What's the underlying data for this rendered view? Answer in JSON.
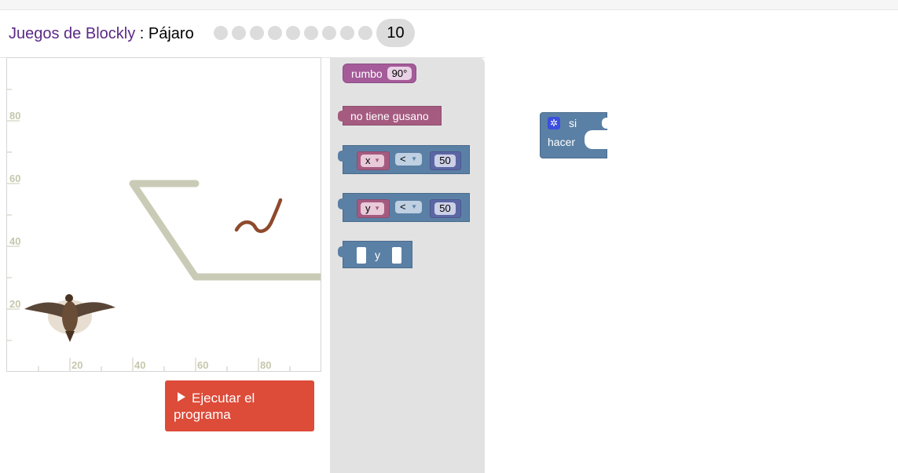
{
  "header": {
    "games_link": "Juegos de Blockly",
    "separator": " : ",
    "game_name": "Pájaro",
    "levels": [
      "1",
      "2",
      "3",
      "4",
      "5",
      "6",
      "7",
      "8",
      "9"
    ],
    "current_level": "10"
  },
  "visualization": {
    "y_axis_labels": [
      "80",
      "60",
      "40",
      "20"
    ],
    "x_axis_labels": [
      "20",
      "40",
      "60",
      "80"
    ],
    "grid_color": "#c9cab4",
    "wall_color": "#cacbb6"
  },
  "run_button": {
    "label_line1": "Ejecutar el",
    "label_line2": "programa",
    "color": "#dd4b39"
  },
  "toolbox": {
    "heading_block": {
      "label": "rumbo",
      "value": "90°"
    },
    "no_worm_block": {
      "label": "no tiene gusano"
    },
    "compare_x": {
      "var": "x",
      "op": "<",
      "value": "50"
    },
    "compare_y": {
      "var": "y",
      "op": "<",
      "value": "50"
    },
    "and_block": {
      "label": "y"
    }
  },
  "workspace": {
    "if_block": {
      "if_label": "si",
      "do_label": "hacer"
    }
  },
  "colors": {
    "logic_block": "#5b80a5",
    "heading_block": "#a55b99",
    "worm_block": "#a55b80",
    "flyout_bg": "#e2e2e2",
    "title_link": "#5b2a86"
  }
}
